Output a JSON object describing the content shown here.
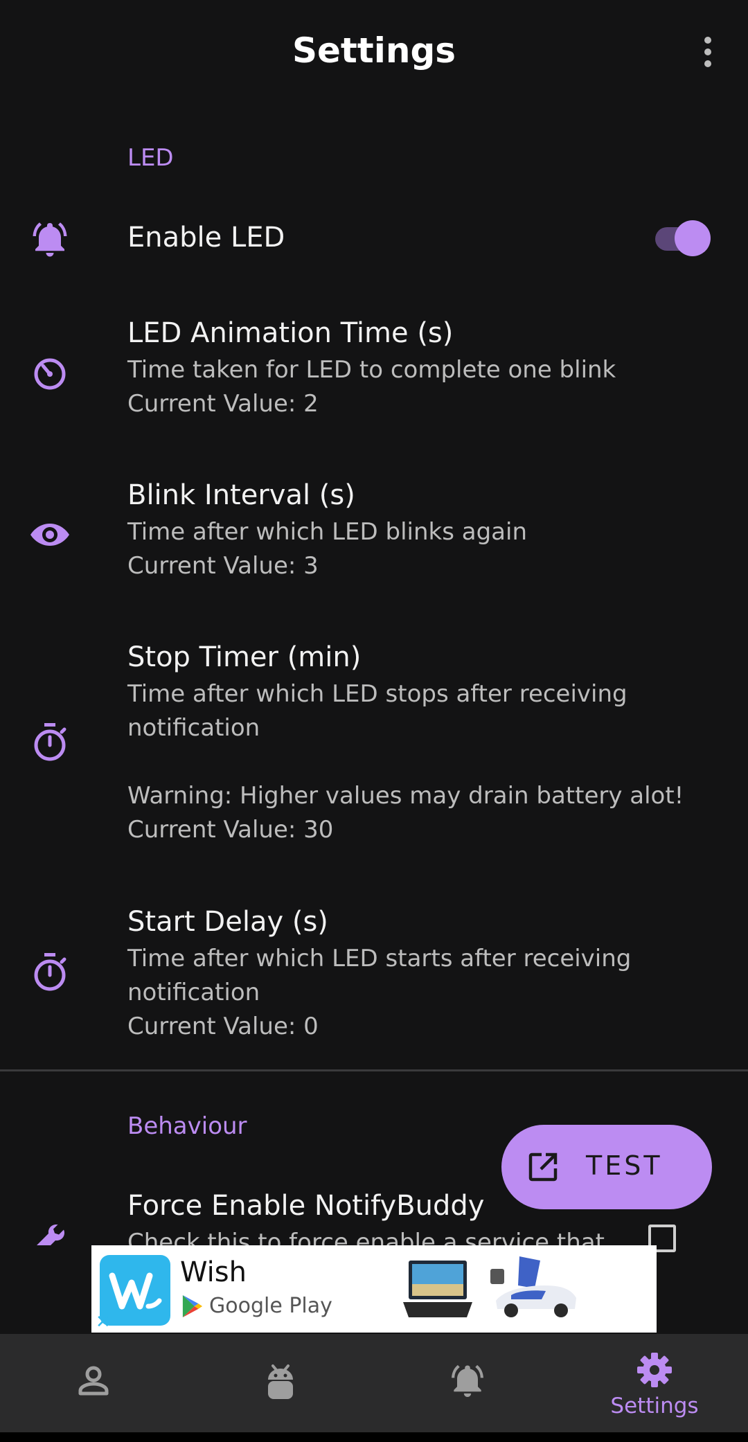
{
  "header": {
    "title": "Settings",
    "more_icon": "more-vert-icon"
  },
  "sections": {
    "led": {
      "label": "LED"
    },
    "behaviour": {
      "label": "Behaviour"
    }
  },
  "settings": {
    "enable_led": {
      "icon": "notifications-active-icon",
      "title": "Enable LED",
      "enabled": true
    },
    "animation_time": {
      "icon": "timelapse-icon",
      "title": "LED Animation Time (s)",
      "line1": "Time taken for LED to complete one blink",
      "line2": "Current Value: 2"
    },
    "blink_interval": {
      "icon": "eye-icon",
      "title": "Blink Interval (s)",
      "line1": "Time after which LED blinks again",
      "line2": "Current Value: 3"
    },
    "stop_timer": {
      "icon": "timer-icon",
      "title": "Stop Timer (min)",
      "line1": "Time after which LED stops after receiving",
      "line2": "notification",
      "line3": "Warning: Higher values may drain battery alot!",
      "line4": "Current Value: 30"
    },
    "start_delay": {
      "icon": "timer-icon",
      "title": "Start Delay (s)",
      "line1": "Time after which LED starts after receiving",
      "line2": "notification",
      "line3": "Current Value: 0"
    },
    "force_enable": {
      "icon": "wrench-icon",
      "title": "Force Enable NotifyBuddy",
      "line1": "Check this to force enable a service that",
      "checked": false
    }
  },
  "fab": {
    "label": "TEST",
    "icon": "open-in-new-icon"
  },
  "ad": {
    "brand": "Wish",
    "store": "Google Play",
    "close_symbol": "✕"
  },
  "bottom_nav": {
    "items": [
      {
        "icon": "person-icon",
        "label": ""
      },
      {
        "icon": "android-icon",
        "label": ""
      },
      {
        "icon": "notifications-active-icon",
        "label": ""
      },
      {
        "icon": "settings-gear-icon",
        "label": "Settings",
        "active": true
      }
    ]
  },
  "colors": {
    "accent": "#bc8cf2",
    "background": "#131314",
    "nav_background": "#2b2b2c",
    "secondary_text": "#bdbdbd"
  }
}
